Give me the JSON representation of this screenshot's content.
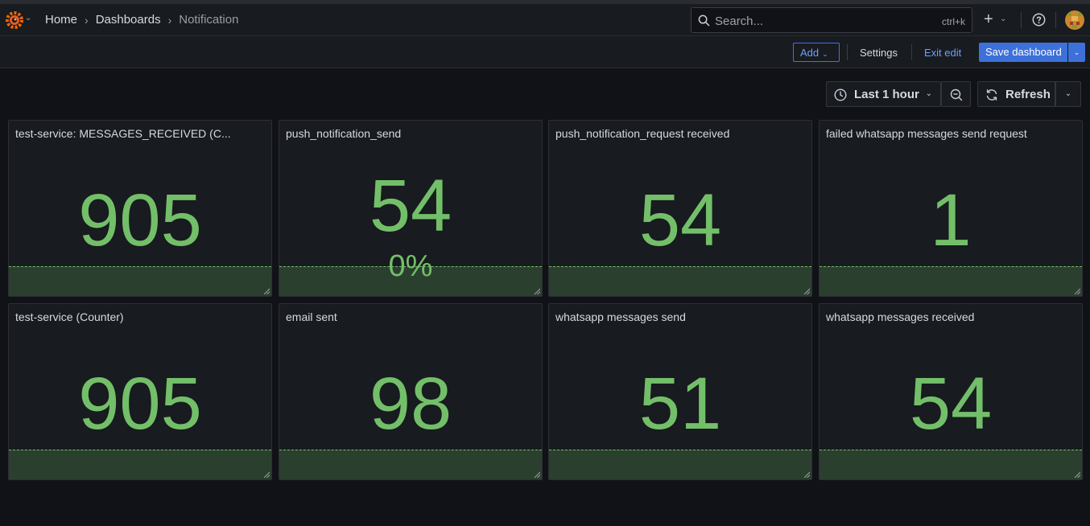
{
  "nav": {
    "breadcrumbs": [
      "Home",
      "Dashboards",
      "Notification"
    ],
    "separator": "›",
    "search_placeholder": "Search...",
    "search_shortcut": "ctrl+k",
    "plus_label": "+",
    "caret": "⌄"
  },
  "toolbar": {
    "add_label": "Add",
    "settings_label": "Settings",
    "exit_label": "Exit edit",
    "save_label": "Save dashboard"
  },
  "time": {
    "range_label": "Last 1 hour",
    "refresh_label": "Refresh"
  },
  "colors": {
    "value_green": "#73bf69",
    "accent_blue": "#3d71d9",
    "link_blue": "#6e9fff"
  },
  "icons": [
    "grafana-logo-icon",
    "search-icon",
    "help-icon",
    "clock-icon",
    "zoom-out-icon",
    "refresh-icon",
    "resize-handle-icon"
  ],
  "panels": [
    {
      "title": "test-service: MESSAGES_RECEIVED (C...",
      "value": "905"
    },
    {
      "title": "push_notification_send",
      "value": "54",
      "sub": "0%"
    },
    {
      "title": "push_notification_request received",
      "value": "54"
    },
    {
      "title": "failed whatsapp messages send request",
      "value": "1"
    },
    {
      "title": "test-service (Counter)",
      "value": "905"
    },
    {
      "title": "email sent",
      "value": "98"
    },
    {
      "title": "whatsapp messages send",
      "value": "51"
    },
    {
      "title": "whatsapp messages received",
      "value": "54"
    }
  ]
}
